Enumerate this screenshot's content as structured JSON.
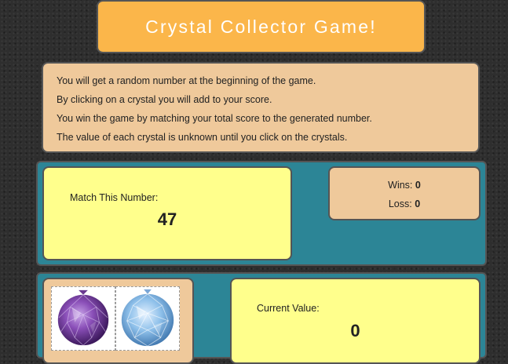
{
  "header": {
    "title": "Crystal Collector Game!"
  },
  "instructions": [
    "You will get a random number at the beginning of the game.",
    "By clicking on a crystal you will add to your score.",
    "You win the game by matching your total score to the generated number.",
    "The value of each crystal is unknown until you click on the crystals."
  ],
  "target": {
    "label": "Match This Number:",
    "value": "47"
  },
  "scoreboard": {
    "wins_label": "Wins:",
    "wins": "0",
    "loss_label": "Loss:",
    "loss": "0"
  },
  "current": {
    "label": "Current Value:",
    "value": "0"
  },
  "crystals": [
    {
      "icon": "purple-crystal-icon",
      "color": "#7b3fa0"
    },
    {
      "icon": "blue-crystal-icon",
      "color": "#6fa3d8"
    }
  ],
  "colors": {
    "title_bg": "#fbb64a",
    "info_bg": "#efc99b",
    "highlight_bg": "#ffff8c",
    "panel_bg": "#2c8596"
  }
}
